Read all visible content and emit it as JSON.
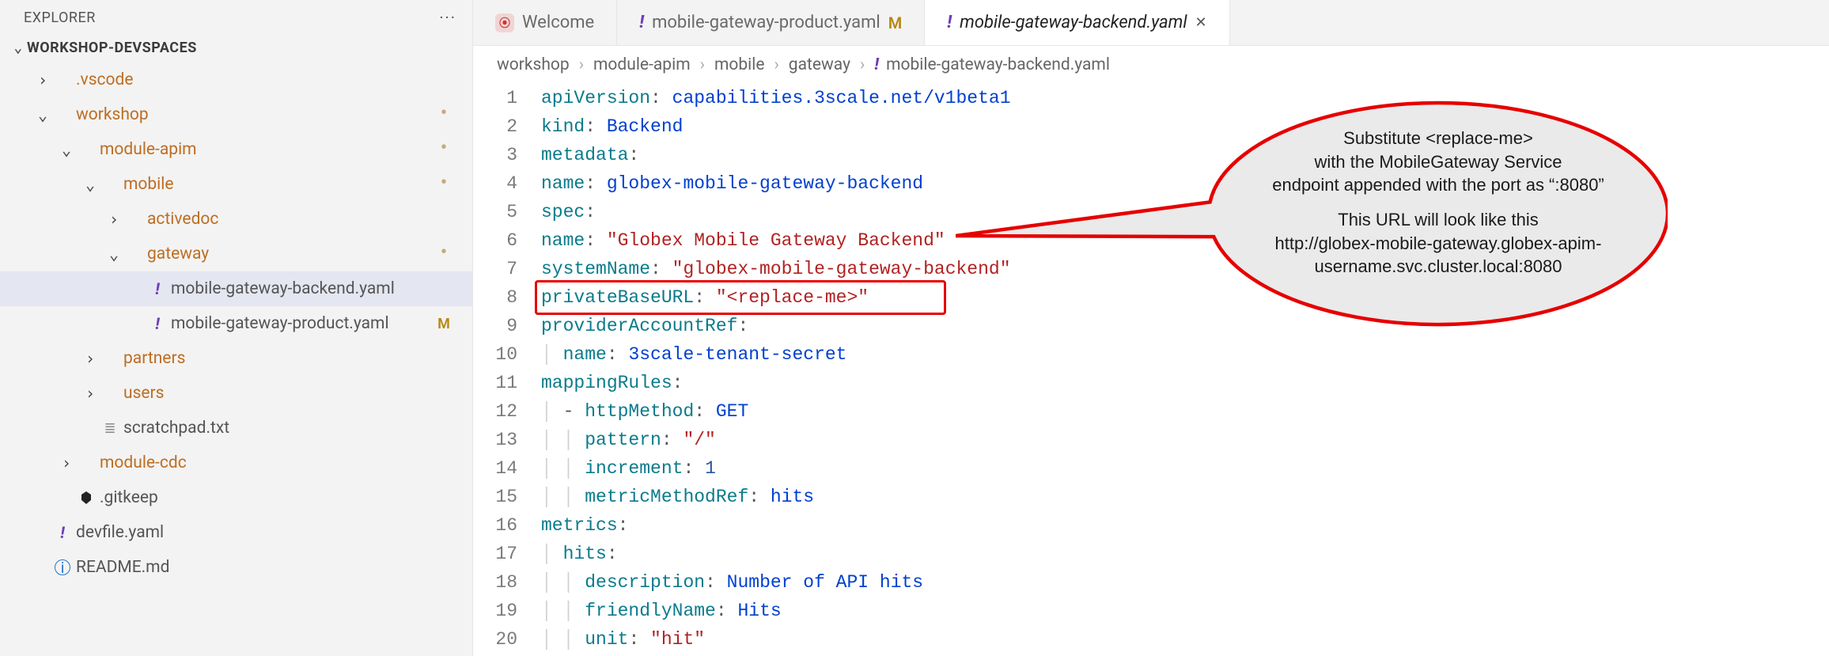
{
  "sidebar": {
    "title": "EXPLORER",
    "section": "WORKSHOP-DEVSPACES",
    "rows": [
      {
        "indent": 0,
        "chev": "›",
        "type": "folder",
        "label": ".vscode"
      },
      {
        "indent": 0,
        "chev": "⌄",
        "type": "folder-open",
        "label": "workshop",
        "badge": "dot"
      },
      {
        "indent": 1,
        "chev": "⌄",
        "type": "folder-open",
        "label": "module-apim",
        "badge": "dot"
      },
      {
        "indent": 2,
        "chev": "⌄",
        "type": "folder-open",
        "label": "mobile",
        "badge": "dot"
      },
      {
        "indent": 3,
        "chev": "›",
        "type": "folder",
        "label": "activedoc"
      },
      {
        "indent": 3,
        "chev": "⌄",
        "type": "folder-open",
        "label": "gateway",
        "badge": "dot"
      },
      {
        "indent": 4,
        "chev": "",
        "type": "yaml",
        "label": "mobile-gateway-backend.yaml",
        "selected": true
      },
      {
        "indent": 4,
        "chev": "",
        "type": "yaml",
        "label": "mobile-gateway-product.yaml",
        "badge": "M"
      },
      {
        "indent": 2,
        "chev": "›",
        "type": "folder",
        "label": "partners"
      },
      {
        "indent": 2,
        "chev": "›",
        "type": "folder",
        "label": "users"
      },
      {
        "indent": 2,
        "chev": "",
        "type": "txt",
        "label": "scratchpad.txt"
      },
      {
        "indent": 1,
        "chev": "›",
        "type": "folder",
        "label": "module-cdc"
      },
      {
        "indent": 1,
        "chev": "",
        "type": "keep",
        "label": ".gitkeep"
      },
      {
        "indent": 0,
        "chev": "",
        "type": "yaml",
        "label": "devfile.yaml"
      },
      {
        "indent": 0,
        "chev": "",
        "type": "info",
        "label": "README.md"
      }
    ]
  },
  "tabs": [
    {
      "kind": "welcome",
      "label": "Welcome"
    },
    {
      "kind": "yaml",
      "label": "mobile-gateway-product.yaml",
      "suffix": "M"
    },
    {
      "kind": "yaml",
      "label": "mobile-gateway-backend.yaml",
      "active": true,
      "closeable": true
    }
  ],
  "breadcrumbs": [
    "workshop",
    "module-apim",
    "mobile",
    "gateway"
  ],
  "breadcrumbs_file": "mobile-gateway-backend.yaml",
  "code": [
    {
      "n": 1,
      "ind": 0,
      "seg": [
        [
          "k",
          "apiVersion"
        ],
        [
          "pn",
          ": "
        ],
        [
          "kw",
          "capabilities.3scale.net/v1beta1"
        ]
      ]
    },
    {
      "n": 2,
      "ind": 0,
      "seg": [
        [
          "k",
          "kind"
        ],
        [
          "pn",
          ": "
        ],
        [
          "kw",
          "Backend"
        ]
      ]
    },
    {
      "n": 3,
      "ind": 0,
      "seg": [
        [
          "k",
          "metadata"
        ],
        [
          "pn",
          ":"
        ]
      ]
    },
    {
      "n": 4,
      "ind": 1,
      "seg": [
        [
          "k",
          "name"
        ],
        [
          "pn",
          ": "
        ],
        [
          "kw",
          "globex-mobile-gateway-backend"
        ]
      ]
    },
    {
      "n": 5,
      "ind": 0,
      "seg": [
        [
          "k",
          "spec"
        ],
        [
          "pn",
          ":"
        ]
      ]
    },
    {
      "n": 6,
      "ind": 1,
      "seg": [
        [
          "k",
          "name"
        ],
        [
          "pn",
          ": "
        ],
        [
          "s",
          "\"Globex Mobile Gateway Backend\""
        ]
      ]
    },
    {
      "n": 7,
      "ind": 1,
      "seg": [
        [
          "k",
          "systemName"
        ],
        [
          "pn",
          ": "
        ],
        [
          "s",
          "\"globex-mobile-gateway-backend\""
        ]
      ]
    },
    {
      "n": 8,
      "ind": 1,
      "seg": [
        [
          "k",
          "privateBaseURL"
        ],
        [
          "pn",
          ": "
        ],
        [
          "s",
          "\"<replace-me>\""
        ]
      ]
    },
    {
      "n": 9,
      "ind": 1,
      "seg": [
        [
          "k",
          "providerAccountRef"
        ],
        [
          "pn",
          ":"
        ]
      ]
    },
    {
      "n": 10,
      "ind": 2,
      "seg": [
        [
          "k",
          "name"
        ],
        [
          "pn",
          ": "
        ],
        [
          "kw",
          "3scale-tenant-secret"
        ]
      ]
    },
    {
      "n": 11,
      "ind": 1,
      "seg": [
        [
          "k",
          "mappingRules"
        ],
        [
          "pn",
          ":"
        ]
      ]
    },
    {
      "n": 12,
      "ind": 2,
      "seg": [
        [
          "pn",
          "- "
        ],
        [
          "k",
          "httpMethod"
        ],
        [
          "pn",
          ": "
        ],
        [
          "kw",
          "GET"
        ]
      ]
    },
    {
      "n": 13,
      "ind": 3,
      "seg": [
        [
          "k",
          "pattern"
        ],
        [
          "pn",
          ": "
        ],
        [
          "s",
          "\"/\""
        ]
      ]
    },
    {
      "n": 14,
      "ind": 3,
      "seg": [
        [
          "k",
          "increment"
        ],
        [
          "pn",
          ": "
        ],
        [
          "nm",
          "1"
        ]
      ]
    },
    {
      "n": 15,
      "ind": 3,
      "seg": [
        [
          "k",
          "metricMethodRef"
        ],
        [
          "pn",
          ": "
        ],
        [
          "kw",
          "hits"
        ]
      ]
    },
    {
      "n": 16,
      "ind": 1,
      "seg": [
        [
          "k",
          "metrics"
        ],
        [
          "pn",
          ":"
        ]
      ]
    },
    {
      "n": 17,
      "ind": 2,
      "seg": [
        [
          "k",
          "hits"
        ],
        [
          "pn",
          ":"
        ]
      ]
    },
    {
      "n": 18,
      "ind": 3,
      "seg": [
        [
          "k",
          "description"
        ],
        [
          "pn",
          ": "
        ],
        [
          "kw",
          "Number of API hits"
        ]
      ]
    },
    {
      "n": 19,
      "ind": 3,
      "seg": [
        [
          "k",
          "friendlyName"
        ],
        [
          "pn",
          ": "
        ],
        [
          "kw",
          "Hits"
        ]
      ]
    },
    {
      "n": 20,
      "ind": 3,
      "seg": [
        [
          "k",
          "unit"
        ],
        [
          "pn",
          ": "
        ],
        [
          "s",
          "\"hit\""
        ]
      ]
    }
  ],
  "callout": {
    "lines": [
      "Substitute <replace-me>",
      "with the MobileGateway Service",
      "endpoint appended with the port as “:8080”",
      "",
      "This URL will look like this",
      "http://globex-mobile-gateway.globex-apim-",
      "username.svc.cluster.local:8080"
    ]
  },
  "colors": {
    "folder": "#bd6e23",
    "key": "#0a7b8c",
    "string": "#b12222",
    "scalar": "#0040d0",
    "accent_red": "#e60000"
  }
}
